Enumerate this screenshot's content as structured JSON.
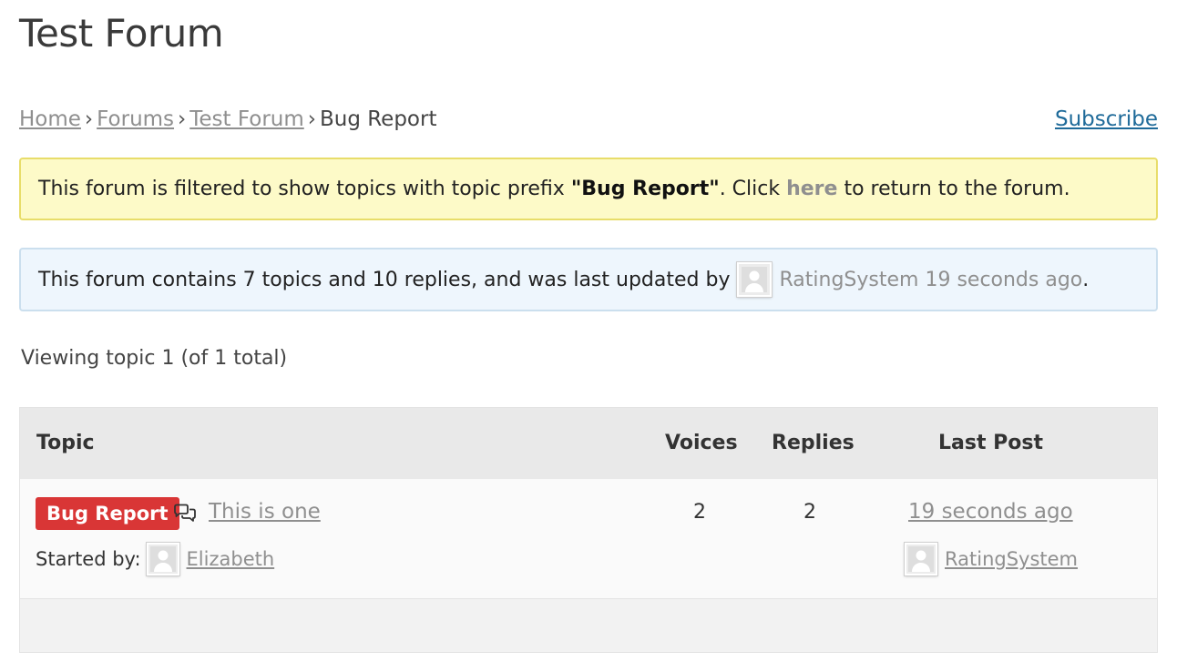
{
  "page": {
    "title": "Test Forum"
  },
  "breadcrumb": {
    "home": "Home",
    "forums": "Forums",
    "forum": "Test Forum",
    "current": "Bug Report",
    "separator": "›"
  },
  "subscribe_label": "Subscribe",
  "filter_notice": {
    "text_before": "This forum is filtered to show topics with topic prefix ",
    "prefix_quoted": "\"Bug Report\"",
    "text_middle": ". Click ",
    "link_label": "here",
    "text_after": " to return to the forum."
  },
  "forum_info": {
    "text": "This forum contains 7 topics and 10 replies, and was last updated by",
    "user": "RatingSystem",
    "time": "19 seconds ago",
    "end": "."
  },
  "pagination": {
    "viewing": "Viewing topic 1 (of 1 total)"
  },
  "table": {
    "headers": {
      "topic": "Topic",
      "voices": "Voices",
      "replies": "Replies",
      "last_post": "Last Post"
    },
    "rows": [
      {
        "prefix": "Bug Report",
        "title": "This is one",
        "started_by_label": "Started by:",
        "author": "Elizabeth",
        "voices": "2",
        "replies": "2",
        "last_post_time": "19 seconds ago",
        "last_post_user": "RatingSystem"
      }
    ]
  },
  "colors": {
    "prefix_badge": "#d93636",
    "link": "#8f8f8f",
    "subscribe_link": "#1e6a99",
    "filter_notice_bg": "#fdfac8",
    "info_notice_bg": "#eef6fd"
  },
  "icons": {
    "topic_icon": "chat-bubbles-icon",
    "avatar": "default-avatar-icon"
  }
}
